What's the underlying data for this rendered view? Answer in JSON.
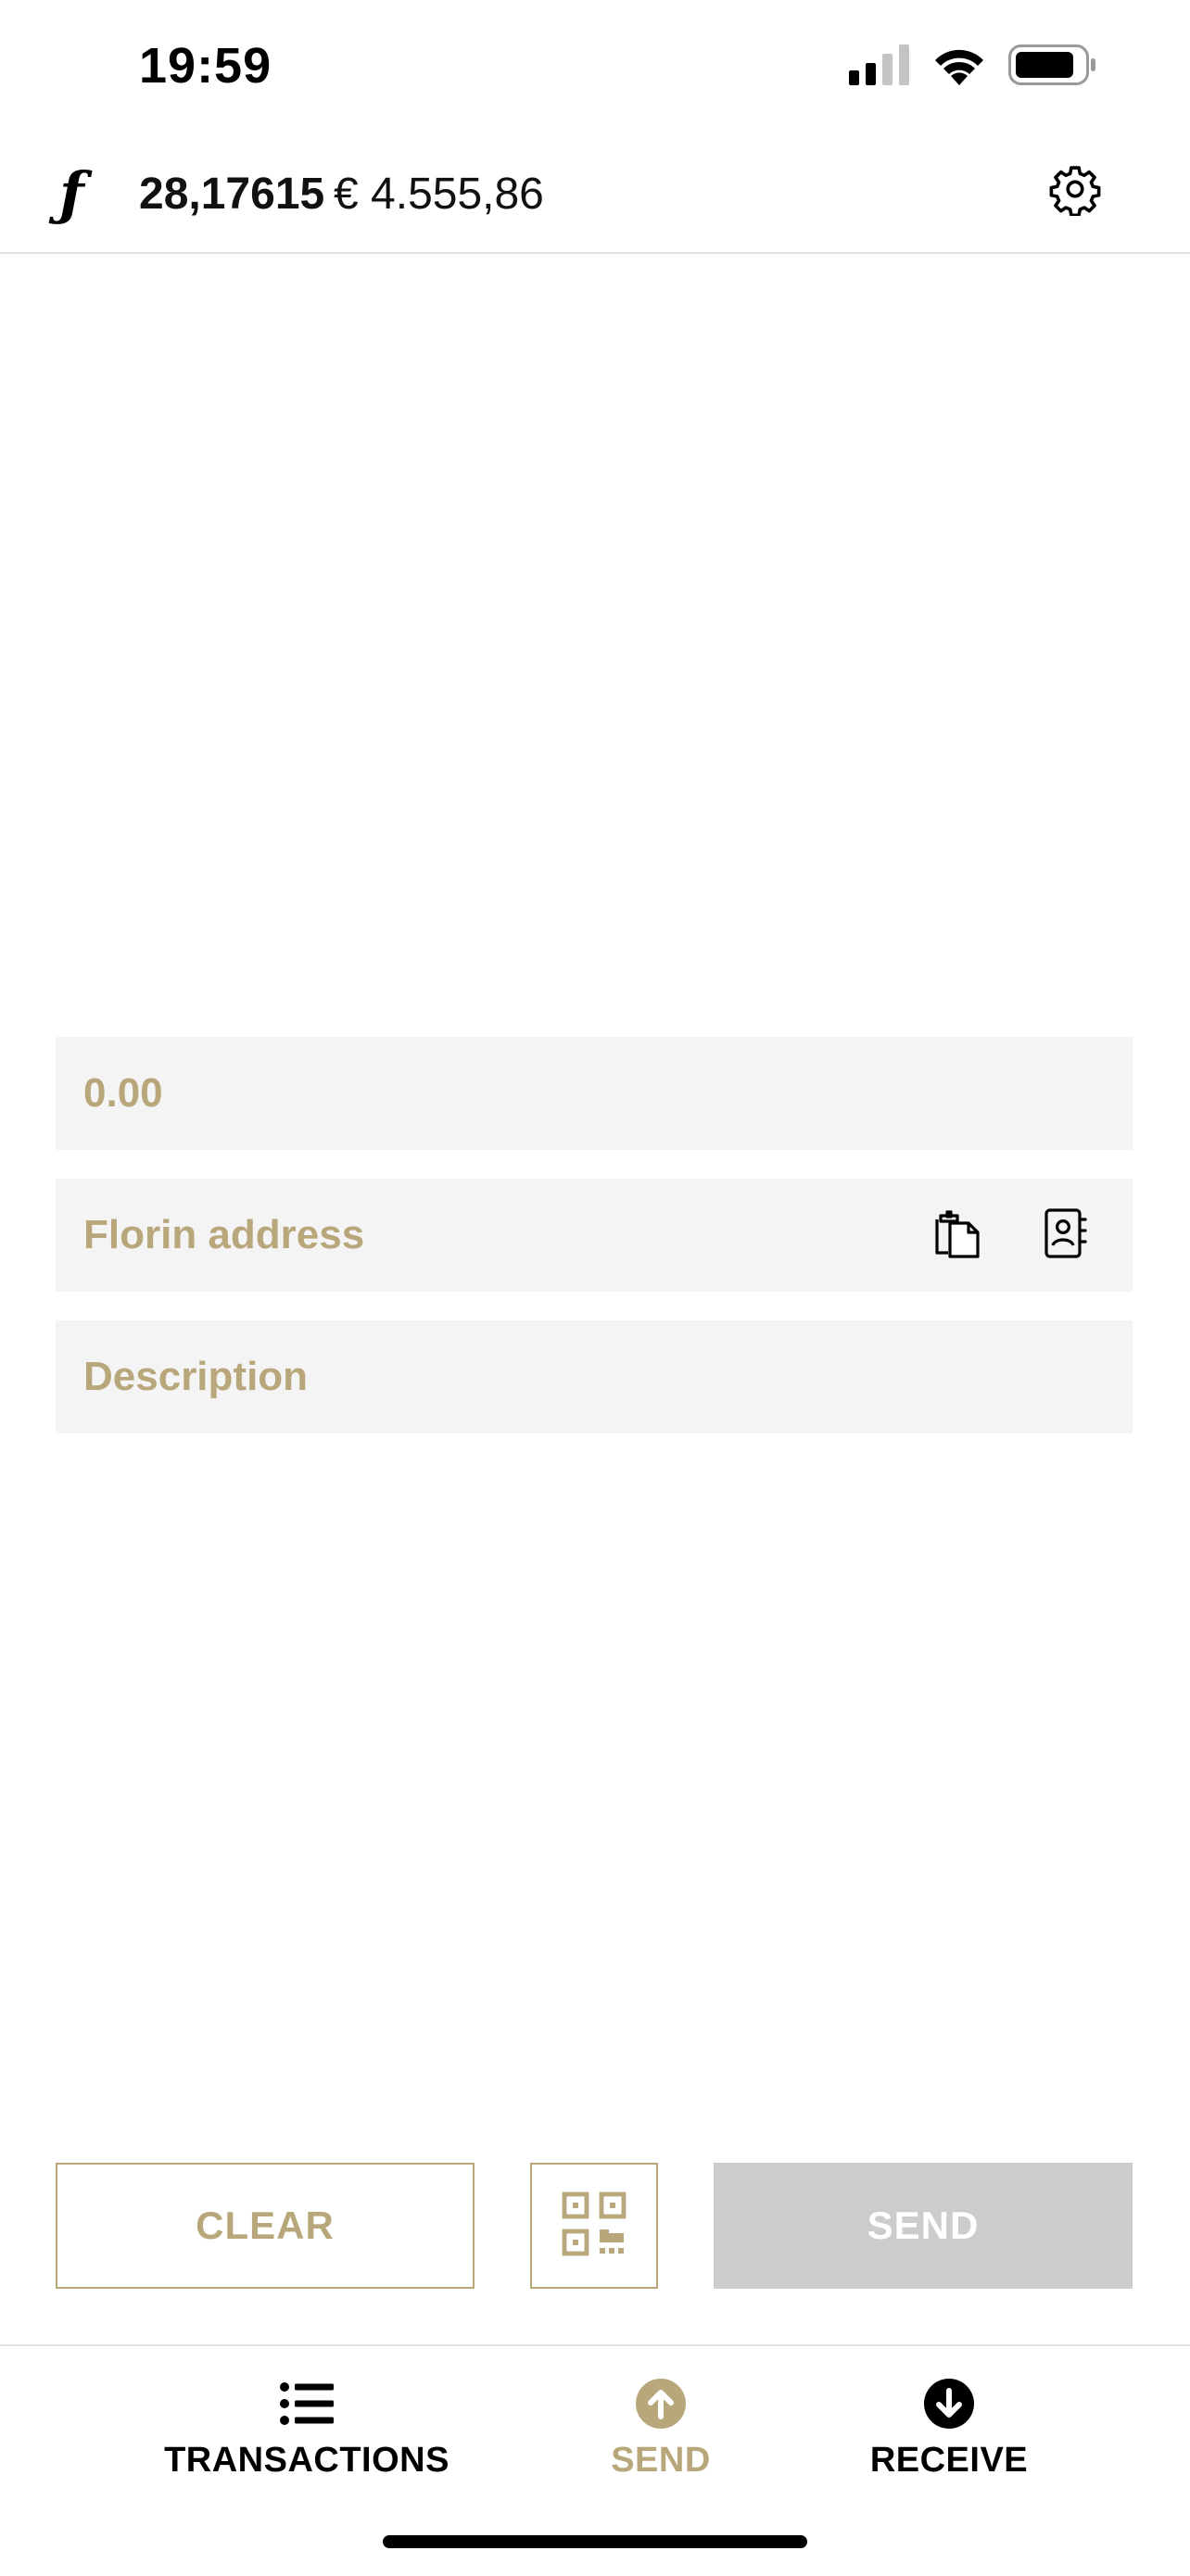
{
  "status_bar": {
    "time": "19:59",
    "icons": [
      "cellular-signal-icon",
      "wifi-icon",
      "battery-icon"
    ]
  },
  "header": {
    "logo_glyph": "ƒ",
    "balance_florin": "28,17615",
    "balance_eur": "€ 4.555,86",
    "settings_icon": "gear-icon"
  },
  "form": {
    "amount_placeholder": "0.00",
    "amount_value": "",
    "address_placeholder": "Florin address",
    "address_value": "",
    "description_placeholder": "Description",
    "description_value": "",
    "address_icons": [
      "paste-icon",
      "contacts-icon"
    ]
  },
  "actions": {
    "clear_label": "CLEAR",
    "qr_icon": "qr-code-icon",
    "send_label": "SEND"
  },
  "tabs": [
    {
      "label": "TRANSACTIONS",
      "icon": "list-icon",
      "active": false
    },
    {
      "label": "SEND",
      "icon": "arrow-up-circle-icon",
      "active": true
    },
    {
      "label": "RECEIVE",
      "icon": "arrow-down-circle-icon",
      "active": false
    }
  ],
  "colors": {
    "accent_gold": "#b8a77a",
    "field_background": "#f4f4f4",
    "disabled_button": "#cccccc",
    "text_dark": "#111111"
  }
}
